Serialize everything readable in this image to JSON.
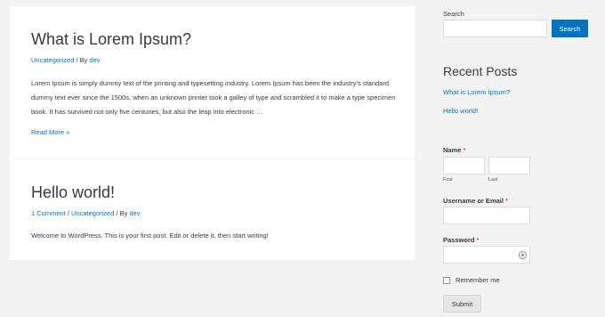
{
  "posts": [
    {
      "title": "What is Lorem Ipsum?",
      "meta": [
        {
          "text": "Uncategorized",
          "link": true
        },
        {
          "text": " / By ",
          "link": false
        },
        {
          "text": "dev",
          "link": true
        }
      ],
      "excerpt": "Lorem Ipsum is simply dummy text of the printing and typesetting industry. Lorem Ipsum has been the industry’s standard dummy text ever since the 1500s, when an unknown printer took a galley of type and scrambled it to make a type specimen book. It has survived not only five centuries, but also the leap into electronic …",
      "read_more": "Read More »"
    },
    {
      "title": "Hello world!",
      "meta": [
        {
          "text": "1 Comment",
          "link": true
        },
        {
          "text": " / ",
          "link": false
        },
        {
          "text": "Uncategorized",
          "link": true
        },
        {
          "text": " / By ",
          "link": false
        },
        {
          "text": "dev",
          "link": true
        }
      ],
      "excerpt": "Welcome to WordPress. This is your first post. Edit or delete it, then start writing!"
    }
  ],
  "sidebar": {
    "search": {
      "label": "Search",
      "button": "Search",
      "value": ""
    },
    "recent": {
      "title": "Recent Posts",
      "items": [
        "What is Lorem Ipsum?",
        "Hello world!"
      ]
    },
    "form": {
      "name_label": "Name",
      "required_mark": "*",
      "first_label": "First",
      "last_label": "Last",
      "username_label": "Username or Email",
      "password_label": "Password",
      "remember_label": "Remember me",
      "submit_label": "Submit"
    }
  },
  "colors": {
    "accent": "#0274be",
    "required": "#cc0000"
  }
}
